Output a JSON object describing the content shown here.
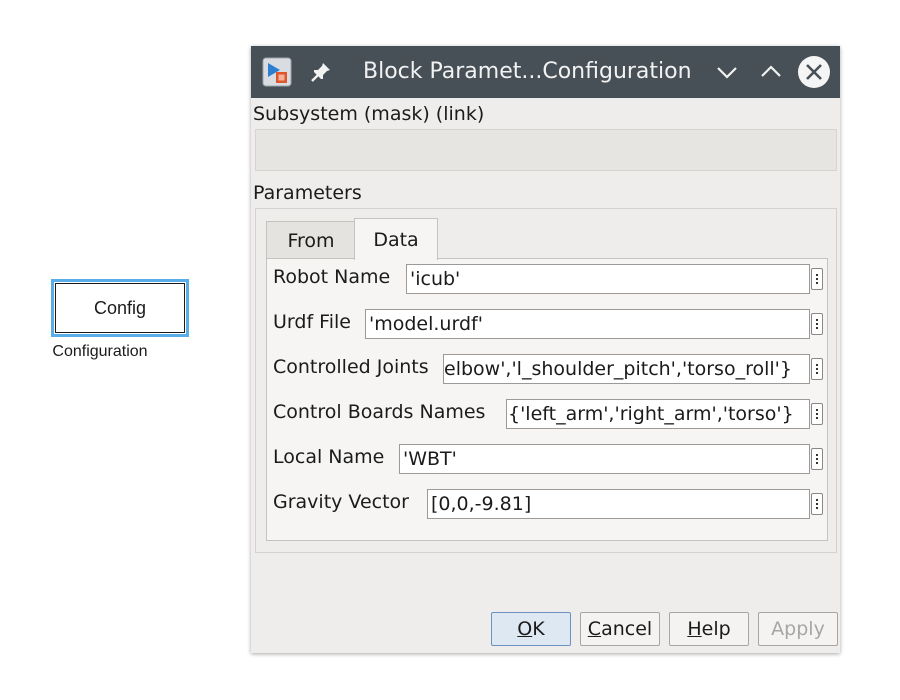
{
  "canvas": {
    "block_label": "Config",
    "block_caption": "Configuration"
  },
  "dialog": {
    "title": "Block Paramet...Configuration",
    "subsystem_label": "Subsystem (mask) (link)",
    "parameters_label": "Parameters",
    "tabs": [
      {
        "label": "From",
        "selected": false
      },
      {
        "label": "Data",
        "selected": true
      }
    ],
    "params": [
      {
        "label": "Robot Name",
        "value": "'icub'"
      },
      {
        "label": "Urdf File",
        "value": "'model.urdf'"
      },
      {
        "label": "Controlled Joints",
        "value": "elbow','l_shoulder_pitch','torso_roll'}"
      },
      {
        "label": "Control Boards Names",
        "value": "{'left_arm','right_arm','torso'}"
      },
      {
        "label": "Local Name",
        "value": "'WBT'"
      },
      {
        "label": "Gravity Vector",
        "value": "[0,0,-9.81]"
      }
    ],
    "buttons": {
      "ok": {
        "u": "O",
        "rest": "K"
      },
      "cancel": {
        "u": "C",
        "rest": "ancel"
      },
      "help": {
        "u": "H",
        "rest": "elp"
      },
      "apply": "Apply"
    }
  },
  "icons": [
    "simulink-app-icon",
    "pin-icon",
    "chevron-down-icon",
    "chevron-up-icon",
    "close-icon",
    "more-options-icon"
  ],
  "colors": {
    "titlebar": "#475057",
    "dialog_bg": "#efedeb",
    "block_highlight": "#5aaee8",
    "ok_button": "#dde8f3"
  }
}
